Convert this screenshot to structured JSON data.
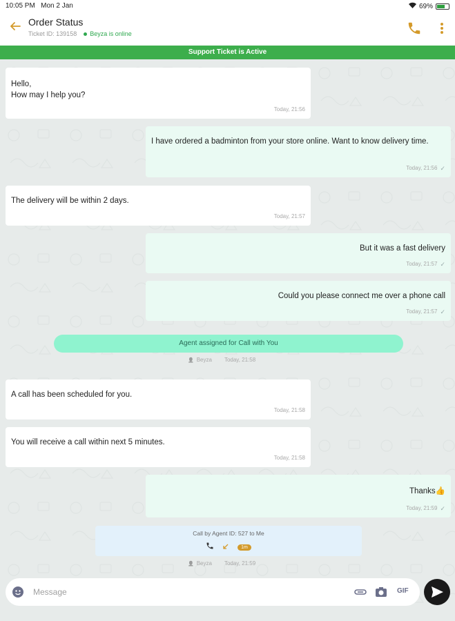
{
  "status_bar": {
    "time": "10:05 PM",
    "date": "Mon 2 Jan",
    "battery": "69%",
    "battery_level": 0.69
  },
  "header": {
    "title": "Order Status",
    "ticket_id": "Ticket ID: 139158",
    "online_status": "Beyza is online",
    "call_icon": "phone-icon",
    "more_icon": "more-vertical-icon",
    "back_icon": "arrow-left-icon"
  },
  "banner": {
    "text": "Support Ticket is Active"
  },
  "messages": [
    {
      "dir": "in",
      "text": "Hello,\nHow may I help you?",
      "meta": "Today, 21:56"
    },
    {
      "dir": "out",
      "text": "I have ordered a badminton from your store online. Want to know delivery time.",
      "meta": "Today, 21:56"
    },
    {
      "dir": "in",
      "text": "The delivery will be within 2 days.",
      "meta": "Today, 21:57"
    },
    {
      "dir": "out",
      "text": "But it was a fast delivery",
      "meta": "Today, 21:57"
    },
    {
      "dir": "out",
      "text": "Could you please connect me over a phone call",
      "meta": "Today, 21:57"
    },
    {
      "dir": "in",
      "text": "A call has been scheduled for you.",
      "meta": "Today, 21:58"
    },
    {
      "dir": "in",
      "text": "You will receive a call within next 5 minutes.",
      "meta": "Today, 21:58"
    },
    {
      "dir": "out",
      "text": "Thanks👍",
      "meta": "Today, 21:59"
    }
  ],
  "event": {
    "text": "Agent assigned for Call with You",
    "agent": "Beyza",
    "time": "Today, 21:58"
  },
  "call_card": {
    "text": "Call by Agent ID: 527 to Me",
    "duration": "1m",
    "agent": "Beyza",
    "time": "Today, 21:59"
  },
  "composer": {
    "placeholder": "Message",
    "gif_label": "GIF"
  },
  "colors": {
    "accent": "#d49a2a",
    "banner": "#3dae4c",
    "event": "#8ff3cf",
    "outgoing": "#eafaf3"
  }
}
